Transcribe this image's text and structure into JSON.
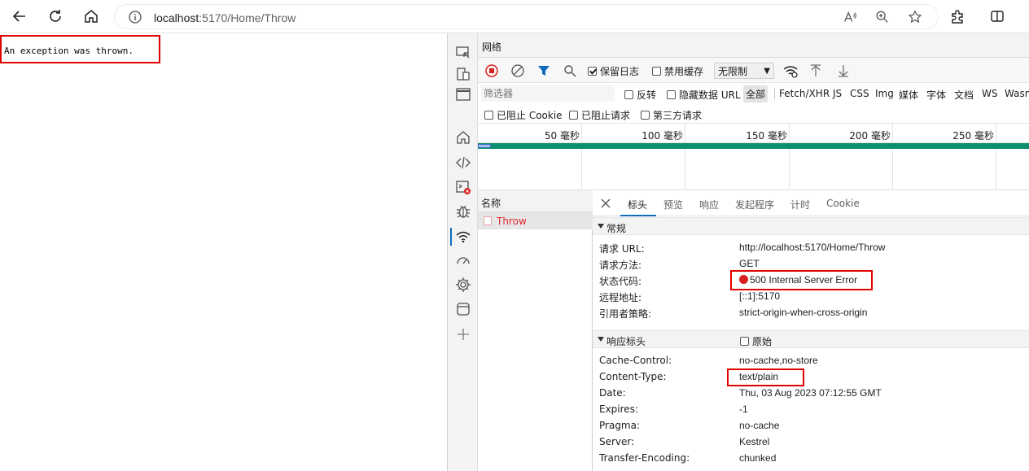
{
  "browser": {
    "url_host": "localhost",
    "url_path": ":5170/Home/Throw",
    "icons": [
      "back-icon",
      "refresh-icon",
      "home-icon",
      "info-icon",
      "read-aloud-icon",
      "zoom-icon",
      "favorite-icon",
      "extensions-icon",
      "split-screen-icon"
    ]
  },
  "page": {
    "message": "An exception was thrown."
  },
  "devtools": {
    "panel_title": "网络",
    "toolbar": {
      "preserve_log": "保留日志",
      "disable_cache": "禁用缓存",
      "throttle": "无限制"
    },
    "filter": {
      "placeholder": "筛选器",
      "invert": "反转",
      "hide_data_urls": "隐藏数据 URL",
      "types": [
        "全部",
        "Fetch/XHR",
        "JS",
        "CSS",
        "Img",
        "媒体",
        "字体",
        "文档",
        "WS",
        "Wasm"
      ],
      "blocked_cookies": "已阻止 Cookie",
      "blocked_requests": "已阻止请求",
      "third_party": "第三方请求"
    },
    "timeline": {
      "ticks": [
        "50  毫秒",
        "100  毫秒",
        "150  毫秒",
        "200  毫秒",
        "250  毫秒"
      ]
    },
    "requests": {
      "header": "名称",
      "items": [
        "Throw"
      ]
    },
    "details": {
      "tabs": [
        "标头",
        "预览",
        "响应",
        "发起程序",
        "计时",
        "Cookie"
      ],
      "general": {
        "title": "常规",
        "rows": [
          {
            "k": "请求 URL:",
            "v": "http://localhost:5170/Home/Throw"
          },
          {
            "k": "请求方法:",
            "v": "GET"
          },
          {
            "k": "状态代码:",
            "v": "500 Internal Server Error"
          },
          {
            "k": "远程地址:",
            "v": "[::1]:5170"
          },
          {
            "k": "引用者策略:",
            "v": "strict-origin-when-cross-origin"
          }
        ]
      },
      "response_headers": {
        "title": "响应标头",
        "raw": "原始",
        "rows": [
          {
            "k": "Cache-Control:",
            "v": "no-cache,no-store"
          },
          {
            "k": "Content-Type:",
            "v": "text/plain"
          },
          {
            "k": "Date:",
            "v": "Thu, 03 Aug 2023 07:12:55 GMT"
          },
          {
            "k": "Expires:",
            "v": "-1"
          },
          {
            "k": "Pragma:",
            "v": "no-cache"
          },
          {
            "k": "Server:",
            "v": "Kestrel"
          },
          {
            "k": "Transfer-Encoding:",
            "v": "chunked"
          }
        ]
      }
    }
  },
  "colors": {
    "highlight_box": "#e00000",
    "status_error": "#d92020",
    "accent": "#0f6cbd",
    "timeline_bar": "#0a8f70"
  }
}
